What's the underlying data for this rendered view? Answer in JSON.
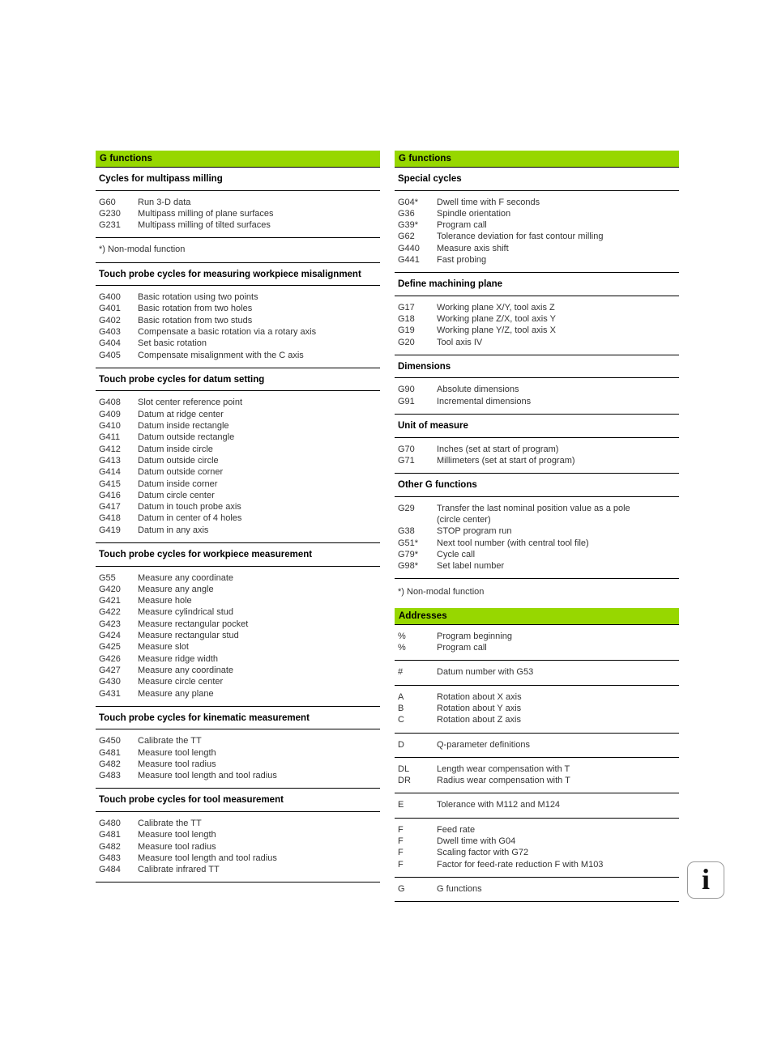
{
  "page": {
    "accent_color": "#97D700",
    "info_icon": "info-icon",
    "info_glyph": "i"
  },
  "left_column": {
    "banner": "G functions",
    "blocks": [
      {
        "type": "heading",
        "title": "Cycles for multipass milling"
      },
      {
        "type": "rows",
        "rows": [
          {
            "code": "G60",
            "desc": "Run 3-D data"
          },
          {
            "code": "G230",
            "desc": "Multipass milling of plane surfaces"
          },
          {
            "code": "G231",
            "desc": "Multipass milling of tilted surfaces"
          }
        ]
      },
      {
        "type": "footnote",
        "text": "*) Non-modal function"
      },
      {
        "type": "heading",
        "title": "Touch probe cycles for measuring workpiece misalignment"
      },
      {
        "type": "rows",
        "rows": [
          {
            "code": "G400",
            "desc": "Basic rotation using two points"
          },
          {
            "code": "G401",
            "desc": "Basic rotation from two holes"
          },
          {
            "code": "G402",
            "desc": "Basic rotation from two studs"
          },
          {
            "code": "G403",
            "desc": "Compensate a basic rotation via a rotary axis"
          },
          {
            "code": "G404",
            "desc": "Set basic rotation"
          },
          {
            "code": "G405",
            "desc": "Compensate misalignment with the C axis"
          }
        ]
      },
      {
        "type": "heading",
        "title": "Touch probe cycles for datum setting"
      },
      {
        "type": "rows",
        "rows": [
          {
            "code": "G408",
            "desc": "Slot center reference point"
          },
          {
            "code": "G409",
            "desc": "Datum at ridge center"
          },
          {
            "code": "G410",
            "desc": "Datum inside rectangle"
          },
          {
            "code": "G411",
            "desc": "Datum outside rectangle"
          },
          {
            "code": "G412",
            "desc": "Datum inside circle"
          },
          {
            "code": "G413",
            "desc": "Datum outside circle"
          },
          {
            "code": "G414",
            "desc": "Datum outside corner"
          },
          {
            "code": "G415",
            "desc": "Datum inside corner"
          },
          {
            "code": "G416",
            "desc": "Datum circle center"
          },
          {
            "code": "G417",
            "desc": "Datum in touch probe axis"
          },
          {
            "code": "G418",
            "desc": "Datum in center of 4 holes"
          },
          {
            "code": "G419",
            "desc": "Datum in any axis"
          }
        ]
      },
      {
        "type": "heading",
        "title": "Touch probe cycles for workpiece measurement"
      },
      {
        "type": "rows",
        "rows": [
          {
            "code": "G55",
            "desc": "Measure any coordinate"
          },
          {
            "code": "G420",
            "desc": "Measure any angle"
          },
          {
            "code": "G421",
            "desc": "Measure hole"
          },
          {
            "code": "G422",
            "desc": "Measure cylindrical stud"
          },
          {
            "code": "G423",
            "desc": "Measure rectangular pocket"
          },
          {
            "code": "G424",
            "desc": "Measure rectangular stud"
          },
          {
            "code": "G425",
            "desc": "Measure slot"
          },
          {
            "code": "G426",
            "desc": "Measure ridge width"
          },
          {
            "code": "G427",
            "desc": "Measure any coordinate"
          },
          {
            "code": "G430",
            "desc": "Measure circle center"
          },
          {
            "code": "G431",
            "desc": "Measure any plane"
          }
        ]
      },
      {
        "type": "heading",
        "title": "Touch probe cycles for kinematic measurement"
      },
      {
        "type": "rows",
        "rows": [
          {
            "code": "G450",
            "desc": "Calibrate the TT"
          },
          {
            "code": "G481",
            "desc": "Measure tool length"
          },
          {
            "code": "G482",
            "desc": "Measure tool radius"
          },
          {
            "code": "G483",
            "desc": "Measure tool length and tool radius"
          }
        ]
      },
      {
        "type": "heading",
        "title": "Touch probe cycles for tool measurement"
      },
      {
        "type": "rows",
        "rows": [
          {
            "code": "G480",
            "desc": "Calibrate the TT"
          },
          {
            "code": "G481",
            "desc": "Measure tool length"
          },
          {
            "code": "G482",
            "desc": "Measure tool radius"
          },
          {
            "code": "G483",
            "desc": "Measure tool length and tool radius"
          },
          {
            "code": "G484",
            "desc": "Calibrate infrared TT"
          }
        ]
      }
    ]
  },
  "right_column": {
    "banner": "G functions",
    "addresses_banner": "Addresses",
    "blocks": [
      {
        "type": "heading",
        "title": "Special cycles"
      },
      {
        "type": "rows",
        "rows": [
          {
            "code": "G04*",
            "desc": "Dwell time with F seconds"
          },
          {
            "code": "G36",
            "desc": "Spindle orientation"
          },
          {
            "code": "G39*",
            "desc": "Program call"
          },
          {
            "code": "G62",
            "desc": "Tolerance deviation for fast contour milling"
          },
          {
            "code": "G440",
            "desc": "Measure axis shift"
          },
          {
            "code": "G441",
            "desc": "Fast probing"
          }
        ]
      },
      {
        "type": "heading",
        "title": "Define machining plane"
      },
      {
        "type": "rows",
        "rows": [
          {
            "code": "G17",
            "desc": "Working plane X/Y, tool axis Z"
          },
          {
            "code": "G18",
            "desc": "Working plane Z/X, tool axis Y"
          },
          {
            "code": "G19",
            "desc": "Working plane Y/Z, tool axis X"
          },
          {
            "code": "G20",
            "desc": "Tool axis IV"
          }
        ]
      },
      {
        "type": "heading",
        "title": "Dimensions"
      },
      {
        "type": "rows",
        "rows": [
          {
            "code": "G90",
            "desc": "Absolute dimensions"
          },
          {
            "code": "G91",
            "desc": "Incremental dimensions"
          }
        ]
      },
      {
        "type": "heading",
        "title": "Unit of measure"
      },
      {
        "type": "rows",
        "rows": [
          {
            "code": "G70",
            "desc": "Inches (set at start of program)"
          },
          {
            "code": "G71",
            "desc": "Millimeters (set at start of program)"
          }
        ]
      },
      {
        "type": "heading",
        "title": "Other G functions"
      },
      {
        "type": "rows",
        "rows": [
          {
            "code": "G29",
            "desc": "Transfer the last nominal position value as a pole",
            "desc2": "(circle center)"
          },
          {
            "code": "G38",
            "desc": "STOP program run"
          },
          {
            "code": "G51*",
            "desc": "Next tool number (with central tool file)"
          },
          {
            "code": "G79*",
            "desc": "Cycle call"
          },
          {
            "code": "G98*",
            "desc": "Set label number"
          }
        ]
      },
      {
        "type": "note",
        "text": "*) Non-modal function"
      }
    ],
    "address_blocks": [
      {
        "type": "rows",
        "rows": [
          {
            "code": "%",
            "desc": "Program beginning"
          },
          {
            "code": "%",
            "desc": "Program call"
          }
        ]
      },
      {
        "type": "rows",
        "rows": [
          {
            "code": "#",
            "desc": "Datum number with G53"
          }
        ]
      },
      {
        "type": "rows",
        "rows": [
          {
            "code": "A",
            "desc": "Rotation about X axis"
          },
          {
            "code": "B",
            "desc": "Rotation about Y axis"
          },
          {
            "code": "C",
            "desc": "Rotation about Z axis"
          }
        ]
      },
      {
        "type": "rows",
        "rows": [
          {
            "code": "D",
            "desc": "Q-parameter definitions"
          }
        ]
      },
      {
        "type": "rows",
        "rows": [
          {
            "code": "DL",
            "desc": "Length wear compensation with T"
          },
          {
            "code": "DR",
            "desc": "Radius wear compensation with T"
          }
        ]
      },
      {
        "type": "rows",
        "rows": [
          {
            "code": "E",
            "desc": "Tolerance with M112 and M124"
          }
        ]
      },
      {
        "type": "rows",
        "rows": [
          {
            "code": "F",
            "desc": "Feed rate"
          },
          {
            "code": "F",
            "desc": "Dwell time with G04"
          },
          {
            "code": "F",
            "desc": "Scaling factor with G72"
          },
          {
            "code": "F",
            "desc": "Factor for feed-rate reduction F with M103"
          }
        ]
      },
      {
        "type": "rows",
        "rows": [
          {
            "code": "G",
            "desc": "G functions"
          }
        ]
      }
    ]
  }
}
